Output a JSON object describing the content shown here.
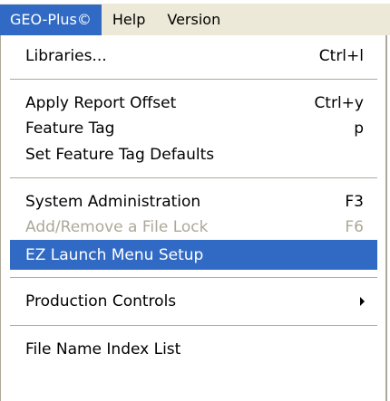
{
  "menubar": {
    "items": [
      {
        "label": "GEO-Plus©",
        "active": true
      },
      {
        "label": "Help"
      },
      {
        "label": "Version"
      }
    ]
  },
  "menu": {
    "libraries": {
      "label": "Libraries...",
      "shortcut": "Ctrl+l"
    },
    "apply_report_offset": {
      "label": "Apply Report Offset",
      "shortcut": "Ctrl+y"
    },
    "feature_tag": {
      "label": "Feature Tag",
      "shortcut": "p"
    },
    "set_feature_tag_defaults": {
      "label": "Set Feature Tag Defaults"
    },
    "system_administration": {
      "label": "System Administration",
      "shortcut": "F3"
    },
    "add_remove_file_lock": {
      "label": "Add/Remove a File Lock",
      "shortcut": "F6",
      "disabled": true
    },
    "ez_launch_menu_setup": {
      "label": "EZ Launch Menu Setup",
      "selected": true
    },
    "production_controls": {
      "label": "Production Controls",
      "submenu": true
    },
    "file_name_index_list": {
      "label": "File Name Index List"
    }
  }
}
